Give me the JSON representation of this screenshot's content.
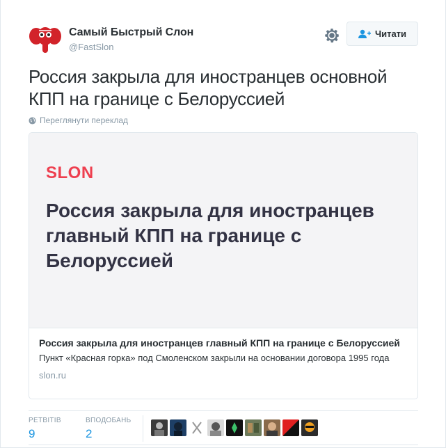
{
  "user": {
    "name": "Самый Быстрый Слон",
    "handle": "@FastSlon"
  },
  "actions": {
    "follow_label": "Читати"
  },
  "tweet": {
    "text": "Россия закрыла для иностранцев основной КПП на границе с Белоруссией",
    "translate_label": "Переглянути переклад"
  },
  "card": {
    "brand": "SLON",
    "headline": "Россия закрыла для иностранцев главный КПП на границе с Белоруссией",
    "title": "Россия закрыла для иностранцев главный КПП на границе с Белоруссией",
    "description": "Пункт «Красная горка» под Смоленском закрыли на основании договора 1995 года",
    "domain": "slon.ru"
  },
  "stats": {
    "retweets_label": "РЕТВІТІВ",
    "retweets_value": "9",
    "likes_label": "ВПОДОБАНЬ",
    "likes_value": "2"
  },
  "colors": {
    "brand_red": "#ee3f4f",
    "link_blue": "#1b95e0",
    "muted": "#8899a6"
  },
  "icons": [
    "gear-icon",
    "follow-user-icon",
    "globe-icon"
  ]
}
